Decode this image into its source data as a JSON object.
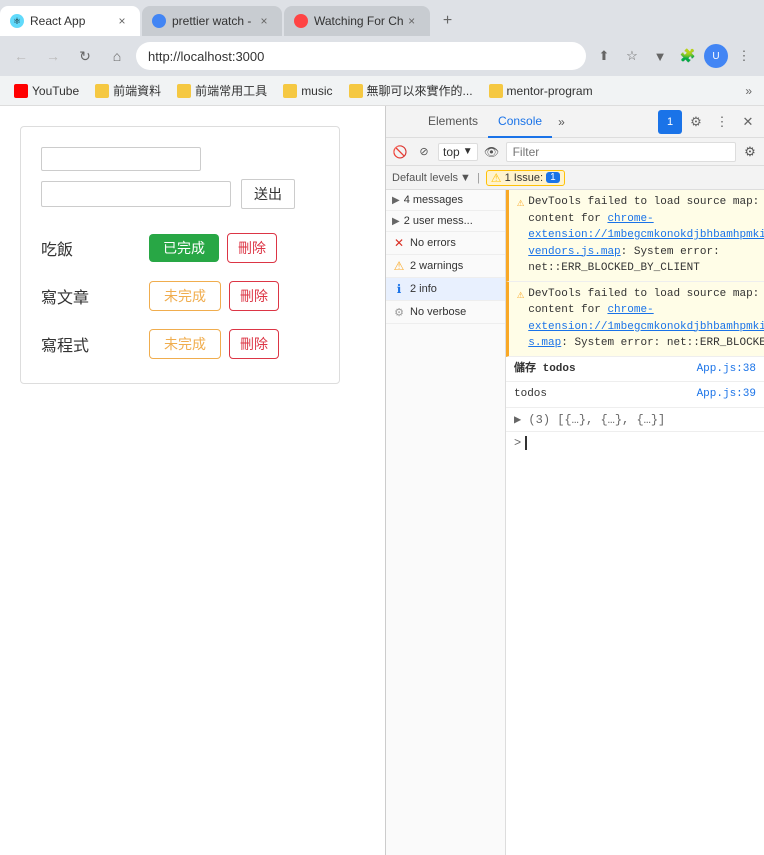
{
  "browser": {
    "tabs": [
      {
        "id": "react",
        "title": "React App",
        "favicon_type": "react",
        "active": true
      },
      {
        "id": "prettier",
        "title": "prettier watch -",
        "favicon_type": "chrome",
        "active": false
      },
      {
        "id": "watching",
        "title": "Watching For Ch",
        "favicon_type": "watching",
        "active": false
      }
    ],
    "new_tab_label": "+",
    "address": "http://localhost:3000",
    "bookmarks": [
      {
        "label": "YouTube",
        "icon_type": "yt"
      },
      {
        "label": "前端資料",
        "icon_type": "folder"
      },
      {
        "label": "前端常用工具",
        "icon_type": "folder"
      },
      {
        "label": "music",
        "icon_type": "folder"
      },
      {
        "label": "無聊可以來實作的...",
        "icon_type": "folder"
      },
      {
        "label": "mentor-program",
        "icon_type": "folder"
      }
    ],
    "bookmark_more": "»"
  },
  "todo_app": {
    "input_top_placeholder": "",
    "input_main_placeholder": "",
    "submit_btn": "送出",
    "items": [
      {
        "label": "吃飯",
        "status": "已完成",
        "done": true,
        "delete": "刪除"
      },
      {
        "label": "寫文章",
        "status": "未完成",
        "done": false,
        "delete": "刪除"
      },
      {
        "label": "寫程式",
        "status": "未完成",
        "done": false,
        "delete": "刪除"
      }
    ]
  },
  "devtools": {
    "tabs": [
      "Elements",
      "Console",
      "»"
    ],
    "active_tab": "Console",
    "badge": "1",
    "icons": [
      "settings",
      "more",
      "close"
    ],
    "toolbar": {
      "top_label": "top",
      "filter_placeholder": "Filter",
      "levels_label": "Default levels",
      "issue_label": "1 Issue:",
      "issue_count": "1"
    },
    "message_list": [
      {
        "label": "4 messages",
        "icon": "none",
        "count": ""
      },
      {
        "label": "2 user mess...",
        "icon": "none",
        "count": ""
      },
      {
        "label": "No errors",
        "icon": "error",
        "count": ""
      },
      {
        "label": "2 warnings",
        "icon": "warning",
        "count": ""
      },
      {
        "label": "2 info",
        "icon": "info",
        "count": ""
      },
      {
        "label": "No verbose",
        "icon": "verbose",
        "count": ""
      }
    ],
    "console_entries": [
      {
        "type": "warning",
        "icon": "⚠",
        "text": "DevTools failed to load source map: Could not load content for chrome-extension://1mbegcmkonokdjbhbamhpmkihpachdbk/chunk-vendors.js.map: System error: net::ERR_BLOCKED_BY_CLIENT",
        "file": ""
      },
      {
        "type": "warning",
        "icon": "⚠",
        "text": "DevTools failed to load source map: Could not load content for chrome-extension://1mbegcmkonokdjbhbamhpmkihpachdbk/content.js.map: System error: net::ERR_BLOCKED_BY_CLIENT",
        "file": ""
      },
      {
        "type": "log",
        "icon": "",
        "label": "儲存 todos",
        "file": "App.js:38"
      },
      {
        "type": "log",
        "icon": "",
        "label": "todos",
        "file": "App.js:39"
      },
      {
        "type": "log",
        "icon": "",
        "label": "▶ (3) [{…}, {…}, {…}]",
        "file": ""
      }
    ]
  }
}
